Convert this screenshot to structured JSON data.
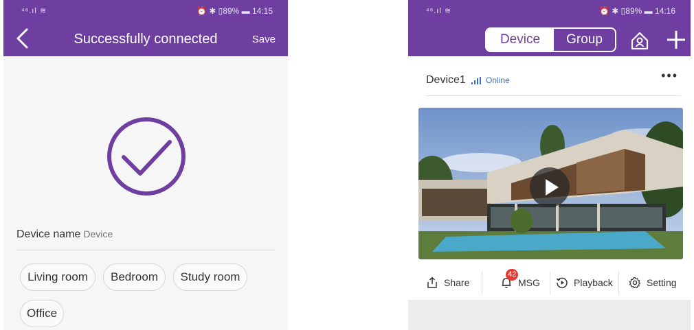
{
  "colors": {
    "brand": "#6e3ea0",
    "link": "#3d6fb5",
    "badge": "#e53935"
  },
  "left_screen": {
    "status": {
      "signal": "⁴⁶.ıl ≋",
      "right": "⏰ ✱ ▯89% ▬ 14:15"
    },
    "title": "Successfully connected",
    "save_label": "Save",
    "back_icon": "chevron-left-icon",
    "check_icon": "check-circle-icon",
    "device_name_label": "Device name",
    "device_name_placeholder": "Device",
    "rooms": [
      "Living room",
      "Bedroom",
      "Study room",
      "Office"
    ]
  },
  "right_screen": {
    "status": {
      "signal": "⁴⁶.ıl ≋",
      "right": "⏰ ✱ ▯89% ▬ 14:16"
    },
    "tabs": [
      {
        "label": "Device",
        "active": true
      },
      {
        "label": "Group",
        "active": false
      }
    ],
    "home_icon": "home-icon",
    "add_icon": "plus-icon",
    "device": {
      "name": "Device1",
      "status": "Online",
      "more_icon": "more-dots-icon"
    },
    "video": {
      "play_icon": "play-icon"
    },
    "actions": [
      {
        "label": "Share",
        "icon": "share-icon"
      },
      {
        "label": "MSG",
        "icon": "bell-icon",
        "badge": "42"
      },
      {
        "label": "Playback",
        "icon": "playback-icon"
      },
      {
        "label": "Setting",
        "icon": "gear-icon"
      }
    ]
  }
}
